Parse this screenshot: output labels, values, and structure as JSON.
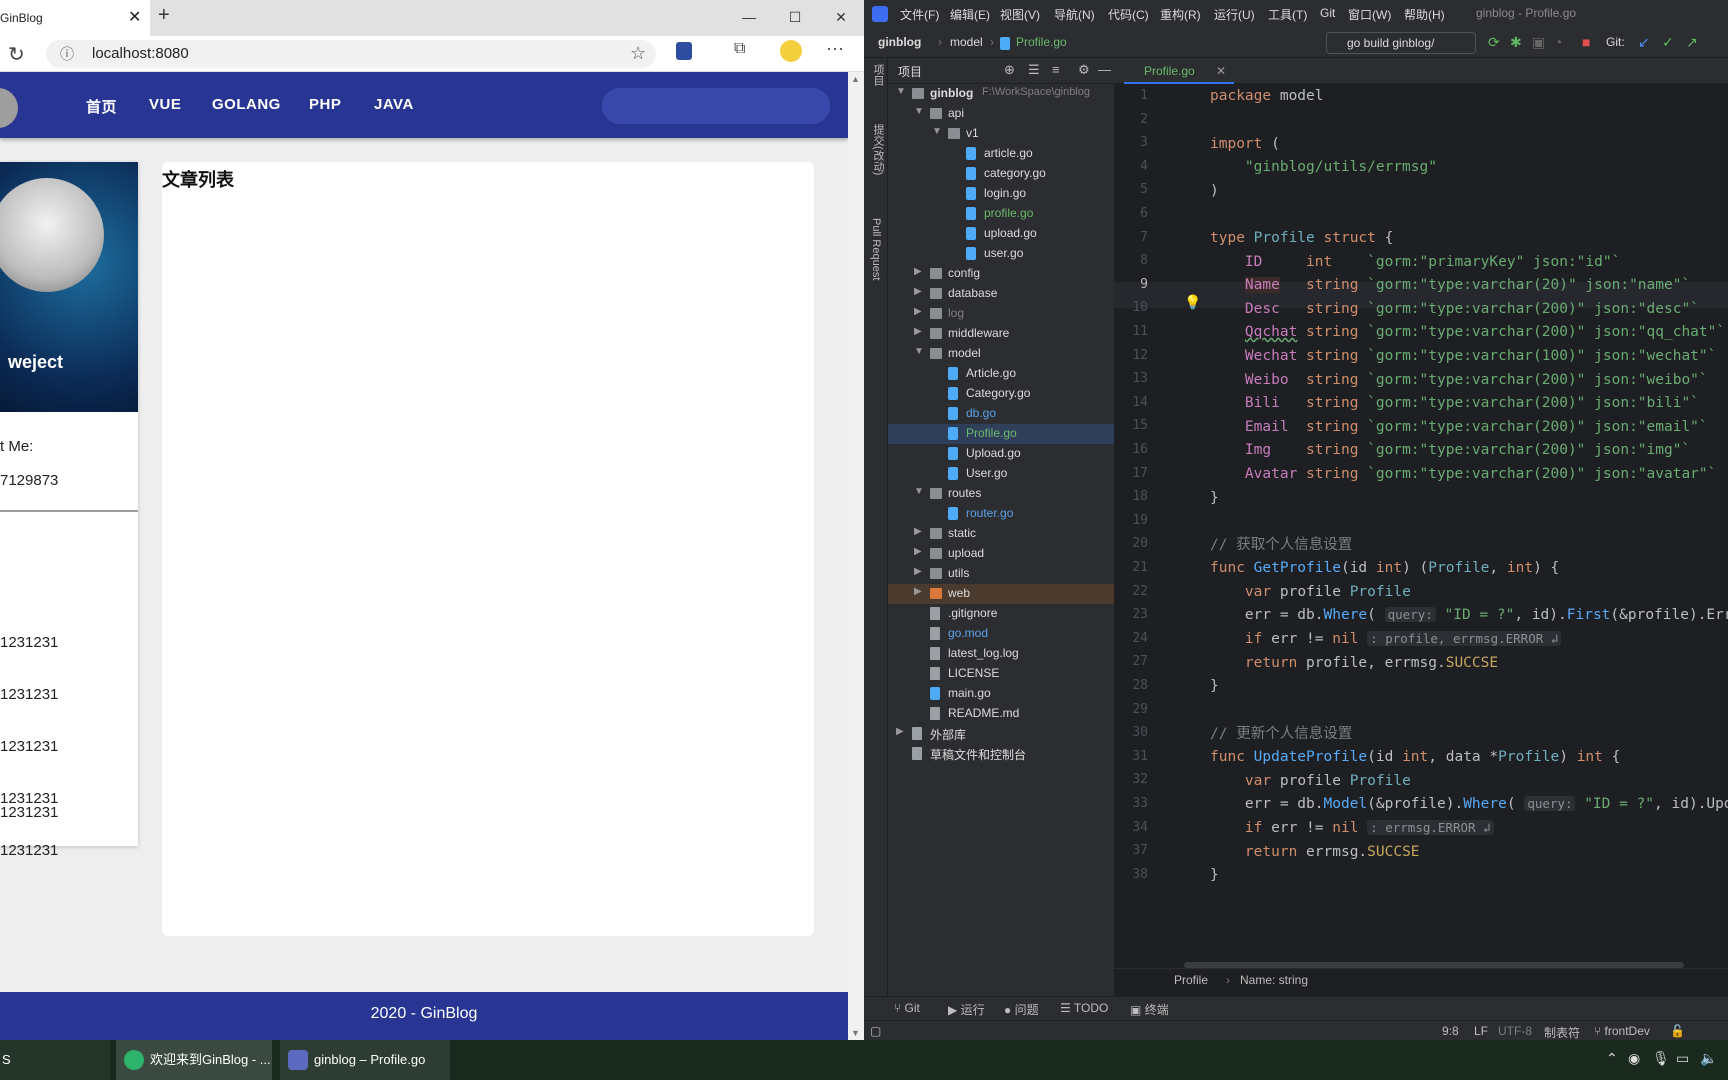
{
  "browser": {
    "tab_title": "GinBlog",
    "tab_close": "✕",
    "new_tab": "+",
    "url": "localhost:8080",
    "reload_icon": "↻",
    "info_icon": "ⓘ",
    "star_icon": "☆",
    "menu_icon": "···"
  },
  "site": {
    "nav": [
      "首页",
      "VUE",
      "GOLANG",
      "PHP",
      "JAVA"
    ],
    "profile_name": "weject",
    "about_label": "t Me:",
    "qq": "7129873",
    "rows": [
      "1231231",
      "1231231",
      "1231231",
      "1231231",
      "1231231",
      "1231231"
    ],
    "list_title": "文章列表",
    "footer": "2020 - GinBlog"
  },
  "ide": {
    "menu": [
      "文件(F)",
      "编辑(E)",
      "视图(V)",
      "导航(N)",
      "代码(C)",
      "重构(R)",
      "运行(U)",
      "工具(T)",
      "Git",
      "窗口(W)",
      "帮助(H)"
    ],
    "window_title": "ginblog - Profile.go",
    "breadcrumb": [
      "ginblog",
      "model",
      "Profile.go"
    ],
    "run_config": "go build ginblog/",
    "git_label": "Git:",
    "project_label": "项目",
    "left_strip": [
      "项目",
      "提交(改动)",
      "Pull Request"
    ],
    "tree": [
      {
        "name": "ginblog",
        "extra": "F:\\WorkSpace\\ginblog",
        "indent": 0,
        "type": "root",
        "open": true
      },
      {
        "name": "api",
        "indent": 1,
        "type": "dir",
        "open": true
      },
      {
        "name": "v1",
        "indent": 2,
        "type": "dir",
        "open": true
      },
      {
        "name": "article.go",
        "indent": 3,
        "type": "go"
      },
      {
        "name": "category.go",
        "indent": 3,
        "type": "go"
      },
      {
        "name": "login.go",
        "indent": 3,
        "type": "go"
      },
      {
        "name": "profile.go",
        "indent": 3,
        "type": "go",
        "color": "green"
      },
      {
        "name": "upload.go",
        "indent": 3,
        "type": "go"
      },
      {
        "name": "user.go",
        "indent": 3,
        "type": "go"
      },
      {
        "name": "config",
        "indent": 1,
        "type": "dir",
        "open": false
      },
      {
        "name": "database",
        "indent": 1,
        "type": "dir",
        "open": false
      },
      {
        "name": "log",
        "indent": 1,
        "type": "dir",
        "open": false,
        "color": "gray"
      },
      {
        "name": "middleware",
        "indent": 1,
        "type": "dir",
        "open": false
      },
      {
        "name": "model",
        "indent": 1,
        "type": "dir",
        "open": true
      },
      {
        "name": "Article.go",
        "indent": 2,
        "type": "go"
      },
      {
        "name": "Category.go",
        "indent": 2,
        "type": "go"
      },
      {
        "name": "db.go",
        "indent": 2,
        "type": "go",
        "color": "blue"
      },
      {
        "name": "Profile.go",
        "indent": 2,
        "type": "go",
        "color": "green",
        "selected": true
      },
      {
        "name": "Upload.go",
        "indent": 2,
        "type": "go"
      },
      {
        "name": "User.go",
        "indent": 2,
        "type": "go"
      },
      {
        "name": "routes",
        "indent": 1,
        "type": "dir",
        "open": true
      },
      {
        "name": "router.go",
        "indent": 2,
        "type": "go",
        "color": "blue"
      },
      {
        "name": "static",
        "indent": 1,
        "type": "dir",
        "open": false
      },
      {
        "name": "upload",
        "indent": 1,
        "type": "dir",
        "open": false
      },
      {
        "name": "utils",
        "indent": 1,
        "type": "dir",
        "open": false
      },
      {
        "name": "web",
        "indent": 1,
        "type": "dir",
        "open": false,
        "highlight": true
      },
      {
        "name": ".gitignore",
        "indent": 1,
        "type": "file"
      },
      {
        "name": "go.mod",
        "indent": 1,
        "type": "mod",
        "color": "blue"
      },
      {
        "name": "latest_log.log",
        "indent": 1,
        "type": "file"
      },
      {
        "name": "LICENSE",
        "indent": 1,
        "type": "file"
      },
      {
        "name": "main.go",
        "indent": 1,
        "type": "go"
      },
      {
        "name": "README.md",
        "indent": 1,
        "type": "file"
      },
      {
        "name": "外部库",
        "indent": 0,
        "type": "lib",
        "open": false
      },
      {
        "name": "草稿文件和控制台",
        "indent": 0,
        "type": "scratch"
      }
    ],
    "editor_tab": "Profile.go",
    "current_line": 9,
    "line_numbers": [
      1,
      2,
      3,
      4,
      5,
      6,
      7,
      8,
      9,
      10,
      11,
      12,
      13,
      14,
      15,
      16,
      17,
      18,
      19,
      20,
      21,
      22,
      23,
      24,
      27,
      28,
      29,
      30,
      31,
      32,
      33,
      34,
      37,
      38
    ],
    "code_crumb": [
      "Profile",
      "Name: string"
    ],
    "toolwindows": [
      "Git",
      "运行",
      "问题",
      "TODO",
      "终端"
    ],
    "status": [
      "9:8",
      "LF",
      "UTF-8",
      "制表符",
      "frontDev"
    ]
  },
  "taskbar": {
    "items": [
      "欢迎来到GinBlog - ...",
      "ginblog – Profile.go"
    ],
    "left_label": "S"
  }
}
